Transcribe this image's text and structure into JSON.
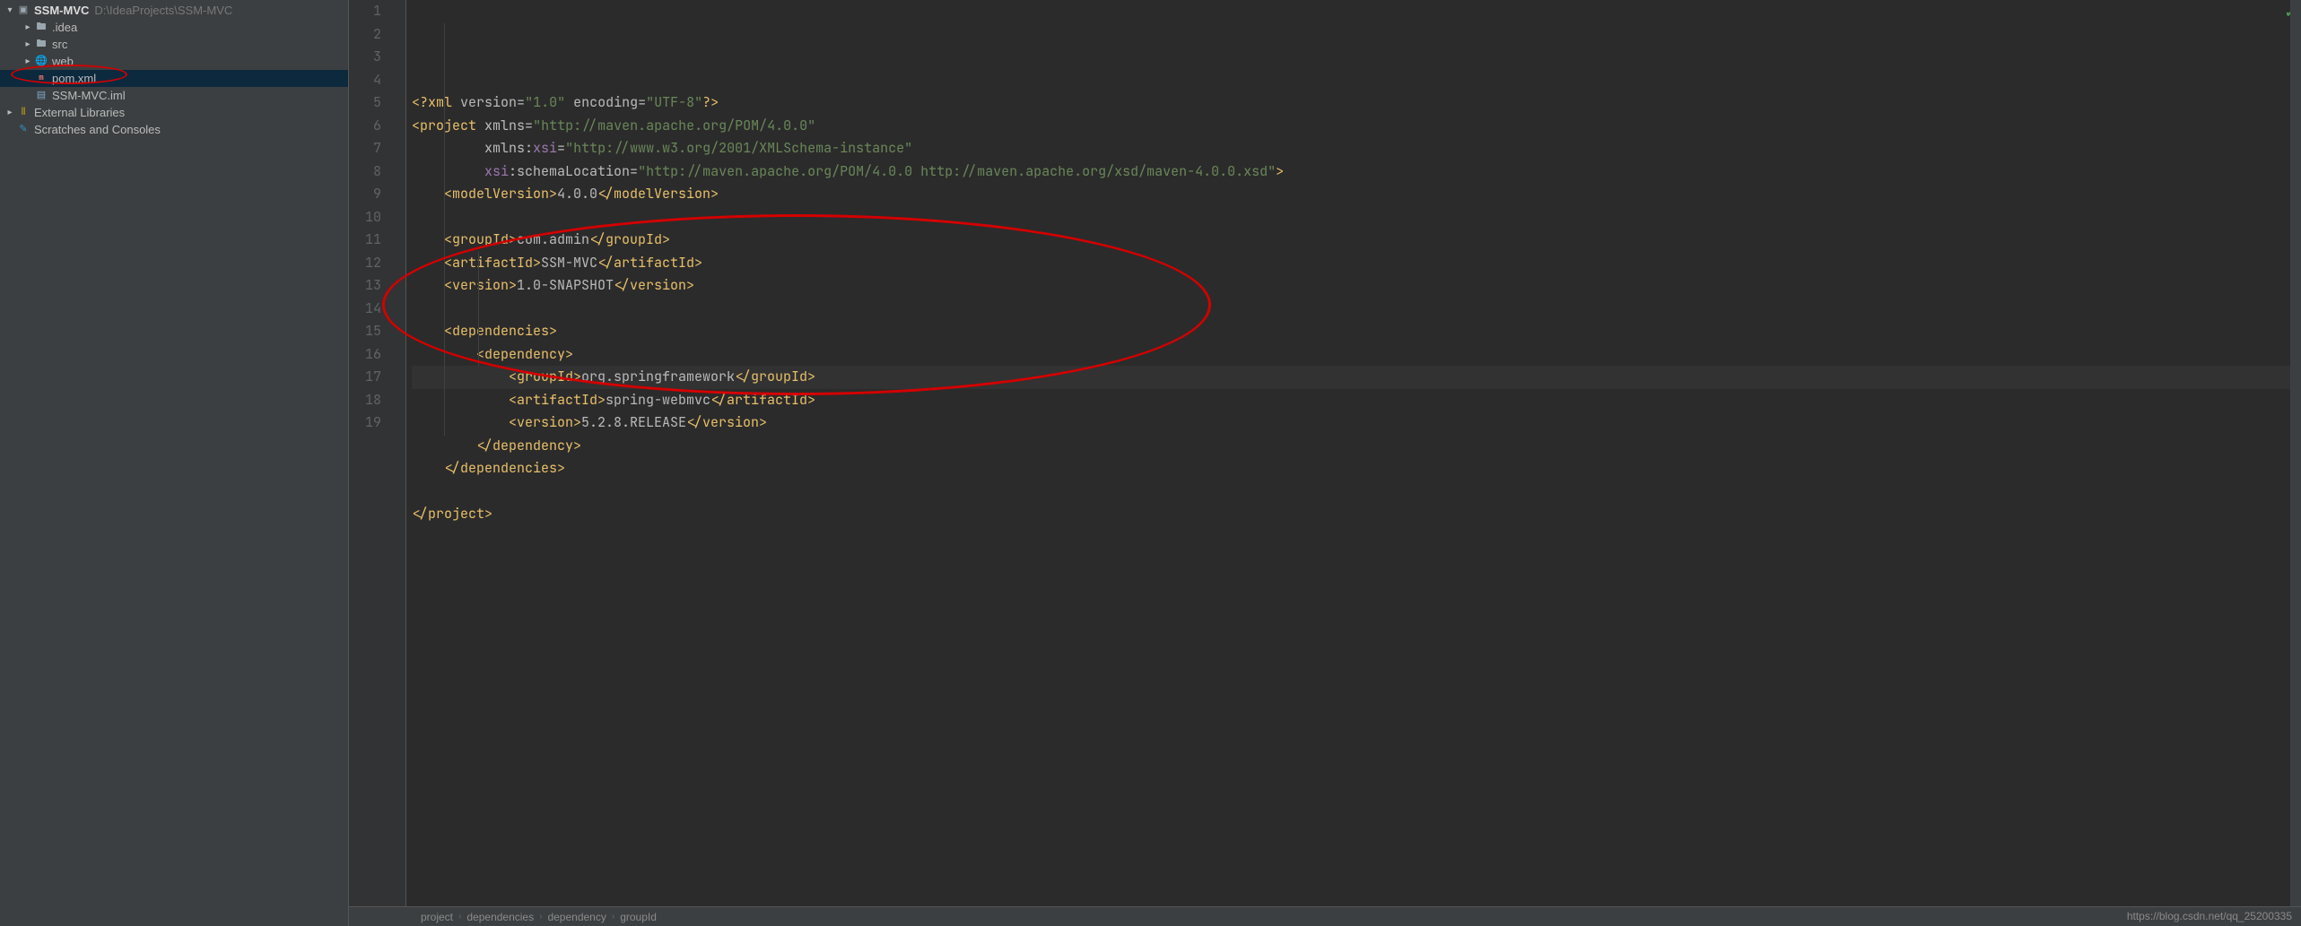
{
  "project": {
    "name": "SSM-MVC",
    "path": "D:\\IdeaProjects\\SSM-MVC",
    "tree": [
      {
        "label": ".idea",
        "kind": "folder",
        "open": false,
        "indent": 1
      },
      {
        "label": "src",
        "kind": "folder",
        "open": false,
        "indent": 1
      },
      {
        "label": "web",
        "kind": "folder",
        "open": false,
        "indent": 1
      },
      {
        "label": "pom.xml",
        "kind": "pom",
        "open": null,
        "indent": 1,
        "selected": true
      },
      {
        "label": "SSM-MVC.iml",
        "kind": "iml",
        "open": null,
        "indent": 1
      }
    ],
    "external_libraries": "External Libraries",
    "scratches": "Scratches and Consoles"
  },
  "pom": {
    "xml_decl": {
      "version": "1.0",
      "encoding": "UTF-8"
    },
    "xmlns": "http://maven.apache.org/POM/4.0.0",
    "xmlns_xsi": "http://www.w3.org/2001/XMLSchema-instance",
    "schemaLocation": "http://maven.apache.org/POM/4.0.0 http://maven.apache.org/xsd/maven-4.0.0.xsd",
    "modelVersion": "4.0.0",
    "groupId": "com.admin",
    "artifactId": "SSM-MVC",
    "version": "1.0-SNAPSHOT",
    "dependencies": [
      {
        "groupId": "org.springframework",
        "artifactId": "spring-webmvc",
        "version": "5.2.8.RELEASE"
      }
    ]
  },
  "breadcrumbs": [
    "project",
    "dependencies",
    "dependency",
    "groupId"
  ],
  "watermark": "https://blog.csdn.net/qq_25200335",
  "line_count": 19
}
